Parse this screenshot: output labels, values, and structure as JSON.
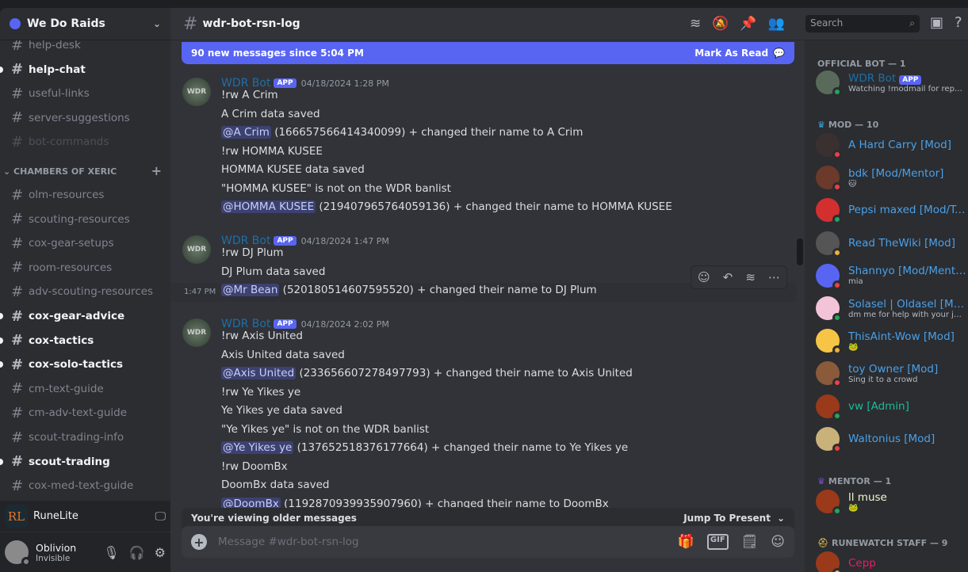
{
  "server": {
    "name": "We Do Raids"
  },
  "channels_top": [
    {
      "name": "help-desk",
      "state": "normal"
    },
    {
      "name": "help-chat",
      "state": "unread"
    },
    {
      "name": "useful-links",
      "state": "normal"
    },
    {
      "name": "server-suggestions",
      "state": "locked"
    },
    {
      "name": "bot-commands",
      "state": "dim"
    }
  ],
  "category": {
    "name": "CHAMBERS OF XERIC",
    "add_icon": "+"
  },
  "channels_cox": [
    {
      "name": "olm-resources",
      "state": "normal"
    },
    {
      "name": "scouting-resources",
      "state": "normal"
    },
    {
      "name": "cox-gear-setups",
      "state": "normal"
    },
    {
      "name": "room-resources",
      "state": "normal"
    },
    {
      "name": "adv-scouting-resources",
      "state": "normal"
    },
    {
      "name": "cox-gear-advice",
      "state": "unread"
    },
    {
      "name": "cox-tactics",
      "state": "unread"
    },
    {
      "name": "cox-solo-tactics",
      "state": "unread"
    },
    {
      "name": "cm-text-guide",
      "state": "normal"
    },
    {
      "name": "cm-adv-text-guide",
      "state": "normal"
    },
    {
      "name": "scout-trading-info",
      "state": "normal"
    },
    {
      "name": "scout-trading",
      "state": "unread"
    },
    {
      "name": "cox-med-text-guide",
      "state": "normal"
    }
  ],
  "activity": {
    "name": "RuneLite",
    "logo": "RL"
  },
  "user": {
    "name": "Oblivion",
    "status": "Invisible"
  },
  "header": {
    "channel": "wdr-bot-rsn-log",
    "search_placeholder": "Search"
  },
  "banner": {
    "text": "90 new messages since 5:04 PM",
    "action": "Mark As Read"
  },
  "messages": [
    {
      "author": "WDR Bot",
      "badge": "APP",
      "timestamp": "04/18/2024 1:28 PM",
      "lines": [
        {
          "text": "!rw A Crim"
        },
        {
          "text": "A Crim data saved"
        },
        {
          "mention": "@A Crim",
          "text": " (166657566414340099) + changed their name to A Crim"
        },
        {
          "text": "!rw HOMMA KUSEE"
        },
        {
          "text": "HOMMA KUSEE data saved"
        },
        {
          "text": "\"HOMMA KUSEE\" is not on the WDR banlist"
        },
        {
          "mention": "@HOMMA KUSEE",
          "text": " (219407965764059136) + changed their name to HOMMA KUSEE"
        }
      ]
    },
    {
      "author": "WDR Bot",
      "badge": "APP",
      "timestamp": "04/18/2024 1:47 PM",
      "hover_time": "1:47 PM",
      "lines": [
        {
          "text": "!rw DJ Plum"
        },
        {
          "text": "DJ Plum data saved"
        },
        {
          "mention": "@Mr Bean",
          "text": " (520180514607595520) + changed their name to DJ Plum"
        }
      ]
    },
    {
      "author": "WDR Bot",
      "badge": "APP",
      "timestamp": "04/18/2024 2:02 PM",
      "lines": [
        {
          "text": "!rw Axis United"
        },
        {
          "text": "Axis United data saved"
        },
        {
          "mention": "@Axis United",
          "text": " (233656607278497793) + changed their name to Axis United"
        },
        {
          "text": "!rw Ye Yikes ye"
        },
        {
          "text": "Ye Yikes ye data saved"
        },
        {
          "text": "\"Ye Yikes ye\" is not on the WDR banlist"
        },
        {
          "mention": "@Ye Yikes ye",
          "text": " (137652518376177664) + changed their name to Ye Yikes ye"
        },
        {
          "text": "!rw DoomBx"
        },
        {
          "text": "DoomBx data saved"
        },
        {
          "mention": "@DoomBx",
          "text": " (1192870939935907960) + changed their name to DoomBx"
        }
      ]
    }
  ],
  "older": {
    "text": "You're viewing older messages",
    "jump": "Jump To Present"
  },
  "composer": {
    "placeholder": "Message #wdr-bot-rsn-log"
  },
  "member_groups": [
    {
      "title": "OFFICIAL BOT — 1",
      "members": [
        {
          "name": "WDR Bot",
          "badge": "APP",
          "sub": "Watching !modmail for reports",
          "status": "online",
          "color": "#1f6fa8"
        }
      ]
    },
    {
      "title": "MOD — 10",
      "icon": "crown-icon",
      "members": [
        {
          "name": "A Hard Carry [Mod]",
          "status": "dnd",
          "color": "#4aa0e8"
        },
        {
          "name": "bdk [Mod/Mentor]",
          "sub": "🐱",
          "status": "dnd",
          "color": "#4aa0e8"
        },
        {
          "name": "Pepsi maxed [Mod/To...",
          "status": "online",
          "color": "#4aa0e8"
        },
        {
          "name": "Read TheWiki [Mod]",
          "status": "idle",
          "color": "#4aa0e8"
        },
        {
          "name": "Shannyo [Mod/Mentor]",
          "sub": "mia",
          "status": "dnd",
          "color": "#4aa0e8"
        },
        {
          "name": "Solasel | Oldasel [Mod]",
          "sub": "dm me for help with your japa...",
          "status": "online",
          "color": "#4aa0e8"
        },
        {
          "name": "ThisAint-Wow [Mod]",
          "sub": "🐸",
          "status": "idle",
          "color": "#4aa0e8"
        },
        {
          "name": "toy Owner [Mod]",
          "sub": "Sing it to a crowd",
          "status": "dnd",
          "color": "#4aa0e8"
        },
        {
          "name": "vw [Admin]",
          "status": "online",
          "color": "#1abc9c"
        },
        {
          "name": "Waltonius [Mod]",
          "status": "dnd",
          "color": "#4aa0e8"
        }
      ]
    },
    {
      "title": "MENTOR — 1",
      "icon": "crown-icon",
      "members": [
        {
          "name": "ll muse",
          "sub": "🐸",
          "status": "online",
          "color": "#f1f8c8"
        }
      ]
    },
    {
      "title": "RUNEWATCH STAFF — 9",
      "icon": "helmet-icon",
      "members": [
        {
          "name": "Cepp",
          "status": "idle",
          "color": "#e91e63"
        }
      ]
    }
  ],
  "colors": {
    "accent": "#5865f2",
    "online": "#23a55a",
    "dnd": "#f23f43",
    "idle": "#f0b232",
    "invisible": "#80848e"
  }
}
